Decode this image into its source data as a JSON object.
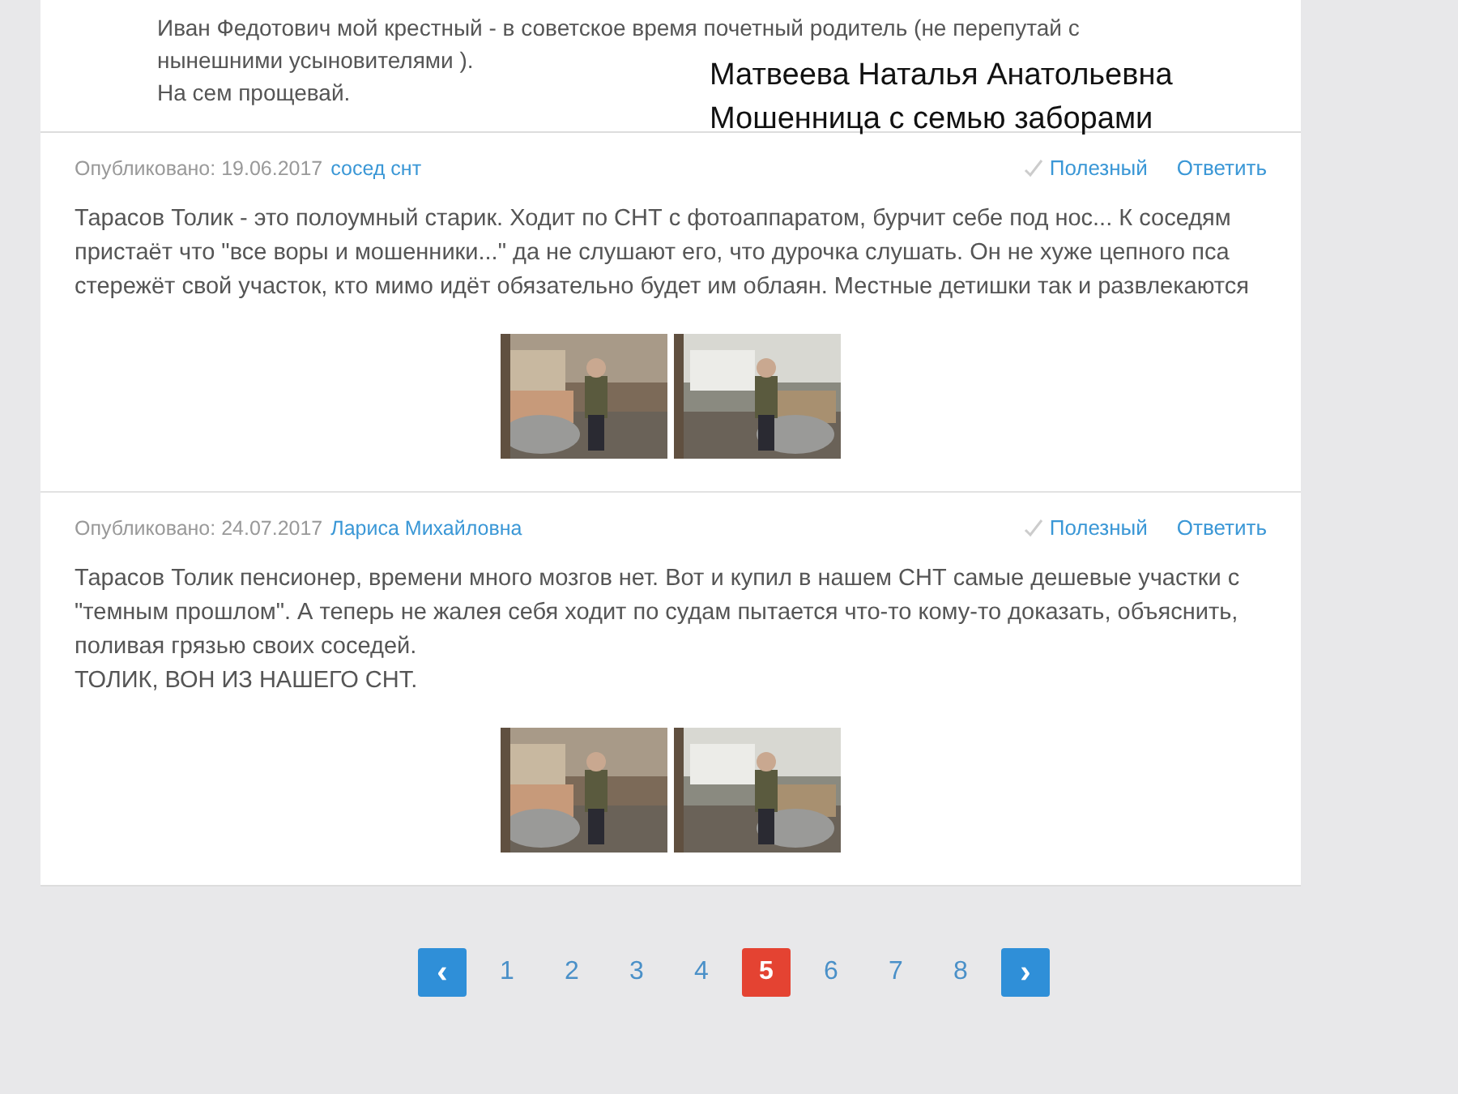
{
  "top_reply": {
    "lines": [
      "Иван Федотович мой крестный - в советское время почетный родитель (не перепутай с",
      "нынешними усыновителями ).",
      "На сем прощевай."
    ]
  },
  "overlay_note": [
    "Матвеева Наталья Анатольевна",
    "Мошенница с семью заборами"
  ],
  "comments": [
    {
      "published": "Опубликовано: 19.06.2017",
      "author": "сосед снт",
      "useful": "Полезный",
      "reply": "Ответить",
      "text": [
        "Тарасов Толик - это полоумный старик. Ходит по СНТ с фотоаппаратом, бурчит себе под нос... К соседям пристаёт что \"все воры и мошенники...\" да не слушают его, что дурочка слушать. Он не хуже цепного пса стережёт свой участок, кто мимо идёт обязательно будет им облаян. Местные детишки так и развлекаются"
      ],
      "photos": [
        {
          "kind": "picture"
        },
        {
          "kind": "picture"
        }
      ]
    },
    {
      "published": "Опубликовано: 24.07.2017",
      "author": "Лариса Михайловна",
      "useful": "Полезный",
      "reply": "Ответить",
      "text": [
        "Тарасов Толик пенсионер, времени много мозгов нет. Вот и купил в нашем СНТ самые дешевые участки с \"темным прошлом\". А теперь не жалея себя ходит по судам пытается что-то кому-то доказать, объяснить, поливая грязью своих соседей.",
        "ТОЛИК, ВОН ИЗ НАШЕГО СНТ."
      ],
      "photos": [
        {
          "kind": "picture"
        },
        {
          "kind": "picture"
        }
      ]
    }
  ],
  "pagination": {
    "prev": "‹",
    "next": "›",
    "pages": [
      {
        "label": "1",
        "selected": false
      },
      {
        "label": "2",
        "selected": false
      },
      {
        "label": "3",
        "selected": false
      },
      {
        "label": "4",
        "selected": false
      },
      {
        "label": "5",
        "selected": true
      },
      {
        "label": "6",
        "selected": false
      },
      {
        "label": "7",
        "selected": false
      },
      {
        "label": "8",
        "selected": false
      }
    ]
  }
}
